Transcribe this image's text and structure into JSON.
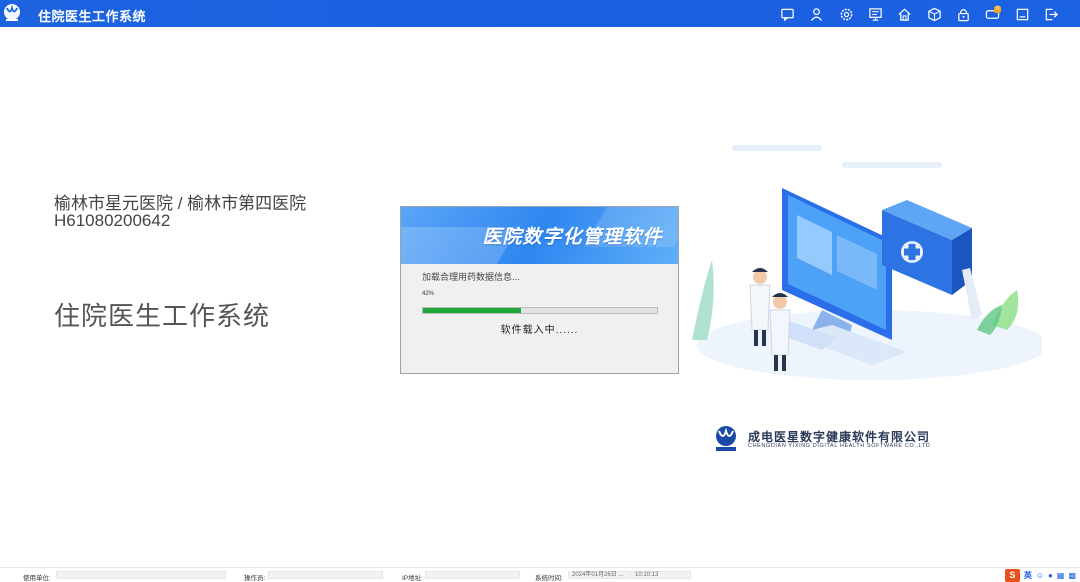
{
  "titlebar": {
    "title": "住院医生工作系统",
    "icons": [
      "message-icon",
      "user-icon",
      "settings-icon",
      "monitor-icon",
      "home-icon",
      "cube-icon",
      "lock-icon",
      "notification-icon",
      "minimize-icon",
      "logout-icon"
    ],
    "notification_badge": "0",
    "brand_color": "#1d63e0"
  },
  "main": {
    "hospital_names": "榆林市星元医院 / 榆林市第四医院",
    "hospital_code": "H61080200642",
    "system_name": "住院医生工作系统"
  },
  "dialog": {
    "banner_title": "医院数字化管理软件",
    "loading_message": "加载合理用药数据信息...",
    "percent_text": "42%",
    "progress": 0.42,
    "loading_sub": "软件载入中......",
    "progress_color": "#1ea836"
  },
  "company": {
    "name": "成电医星数字健康软件有限公司",
    "name_en": "CHENGDIAN YIXING DIGITAL HEALTH SOFTWARE CO.,LTD"
  },
  "statusbar": {
    "unit_label": "使用单位:",
    "operator_label": "操作员:",
    "ip_label": "IP地址:",
    "time_label": "系统时间:",
    "date_value": "2024年01月26日 ...",
    "time_value": "10:10:13",
    "tray_s": "S",
    "tray_lang": "英"
  }
}
